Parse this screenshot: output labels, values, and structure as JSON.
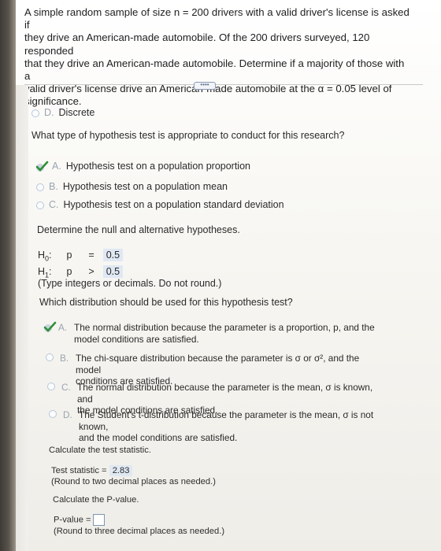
{
  "problem": {
    "line1": "A simple random sample of size n = 200 drivers with a valid driver's license is asked if",
    "line2": "they drive an American-made automobile. Of the 200 drivers surveyed, 120 responded",
    "line3": "that they drive an American-made automobile. Determine if a majority of those with a",
    "line4": "valid driver's license drive an American-made automobile at the α = 0.05 level of",
    "line5": "significance."
  },
  "more_button_label": "••••",
  "prev_option": {
    "letter": "D.",
    "text": "Discrete"
  },
  "q1": {
    "prompt": "What type of hypothesis test is appropriate to conduct for this research?",
    "options": [
      {
        "letter": "A.",
        "text": "Hypothesis test on a population proportion",
        "selected": true
      },
      {
        "letter": "B.",
        "text": "Hypothesis test on a population mean",
        "selected": false
      },
      {
        "letter": "C.",
        "text": "Hypothesis test on a population standard deviation",
        "selected": false
      }
    ]
  },
  "q2": {
    "prompt": "Determine the null and alternative hypotheses.",
    "h0_label": "H",
    "h0_sub": "0",
    "h0_param": "p",
    "h0_op": "=",
    "h0_value": "0.5",
    "h1_label": "H",
    "h1_sub": "1",
    "h1_param": "p",
    "h1_op": ">",
    "h1_value": "0.5",
    "note": "(Type integers or decimals. Do not round.)"
  },
  "q3": {
    "prompt": "Which distribution should be used for this hypothesis test?",
    "options": [
      {
        "letter": "A.",
        "line1": "The normal distribution because the parameter is a proportion, p, and the",
        "line2": "model conditions are satisfied.",
        "selected": true
      },
      {
        "letter": "B.",
        "line1": "The chi-square distribution because the parameter is σ or σ², and the model",
        "line2": "conditions are satisfied.",
        "selected": false
      },
      {
        "letter": "C.",
        "line1": "The normal distribution because the parameter is the mean, σ is known, and",
        "line2": "the model conditions are satisfied.",
        "selected": false
      },
      {
        "letter": "D.",
        "line1": "The Student's t-distribution because the parameter is the mean, σ is not known,",
        "line2": "and the model conditions are satisfied.",
        "selected": false
      }
    ]
  },
  "q4": {
    "prompt": "Calculate the test statistic.",
    "label": "Test statistic =",
    "value": "2.83",
    "note": "(Round to two decimal places as needed.)"
  },
  "q5": {
    "prompt": "Calculate the P-value.",
    "label": "P-value =",
    "value": "",
    "note": "(Round to three decimal places as needed.)"
  },
  "colors": {
    "answer_box": "#dfe8f3",
    "check_green": "#2f8f3a",
    "radio_border": "#b8c6da"
  }
}
